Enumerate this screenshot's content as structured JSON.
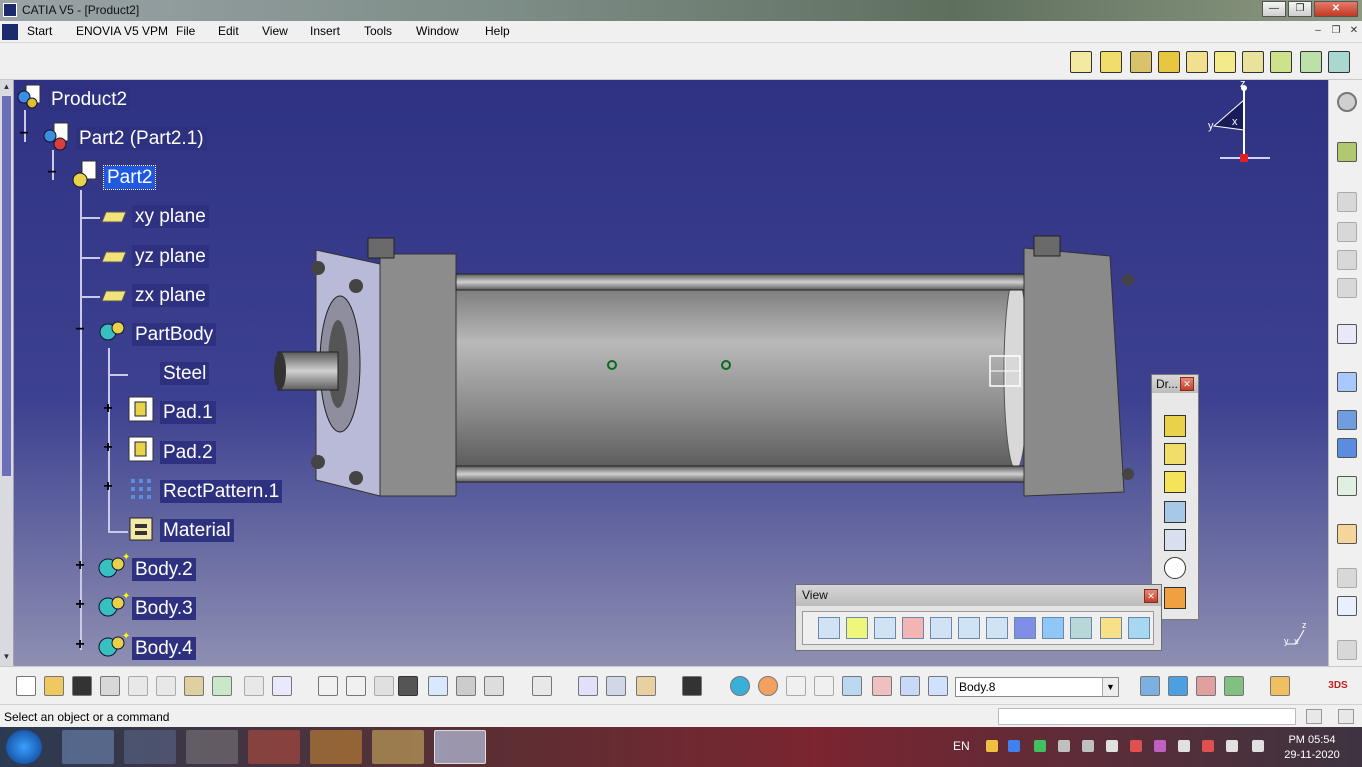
{
  "window": {
    "title": "CATIA V5 - [Product2]"
  },
  "menu": {
    "items": [
      "Start",
      "ENOVIA V5 VPM",
      "File",
      "Edit",
      "View",
      "Insert",
      "Tools",
      "Window",
      "Help"
    ]
  },
  "tree": {
    "product": "Product2",
    "part_instance": "Part2 (Part2.1)",
    "part": "Part2",
    "xy_plane": "xy plane",
    "yz_plane": "yz plane",
    "zx_plane": "zx plane",
    "partbody": "PartBody",
    "steel": "Steel",
    "pad1": "Pad.1",
    "pad2": "Pad.2",
    "rectpattern": "RectPattern.1",
    "material": "Material",
    "body2": "Body.2",
    "body3": "Body.3",
    "body4": "Body.4"
  },
  "compass": {
    "z": "z",
    "y": "y",
    "x": "x"
  },
  "axis_small": {
    "z": "z",
    "y": "y",
    "x": "x"
  },
  "dr_panel": {
    "title": "Dr..."
  },
  "view_panel": {
    "title": "View"
  },
  "bottom_toolbar": {
    "current_body": "Body.8"
  },
  "status": {
    "message": "Select an object or a command"
  },
  "taskbar": {
    "language": "EN",
    "time": "PM 05:54",
    "date": "29-11-2020"
  },
  "colors": {
    "background": "#3b3f86",
    "selection": "#1f59e0"
  }
}
